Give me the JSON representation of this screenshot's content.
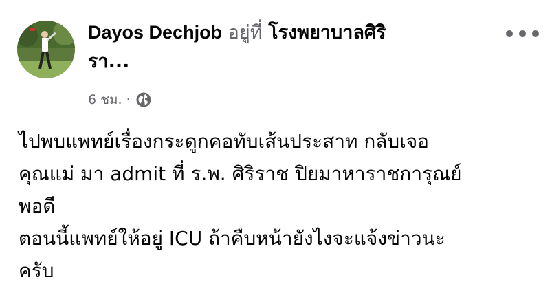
{
  "post": {
    "author": "Dayos Dechjob",
    "at_text": "อยู่ที่",
    "place_line1": "โรงพยาบาลศิริ",
    "place_line2": "รา...",
    "timestamp": "6 ชม.",
    "separator": "·",
    "privacy_icon": "globe-icon",
    "more_icon": "more-dots-icon",
    "text_lines": [
      "ไปพบแพทย์เรื่องกระดูกคอทับเส้นประสาท กลับเจอ",
      "คุณแม่ มา admit ที่ ร.พ. ศิริราช ปิยมาหาราชการุณย์",
      "พอดี",
      "ตอนนี้แพทย์ให้อยู่ ICU ถ้าคืบหน้ายังไงจะแจ้งข่าวนะ",
      "ครับ"
    ]
  },
  "colors": {
    "primary_text": "#050505",
    "secondary_text": "#65676b",
    "background": "#ffffff"
  }
}
